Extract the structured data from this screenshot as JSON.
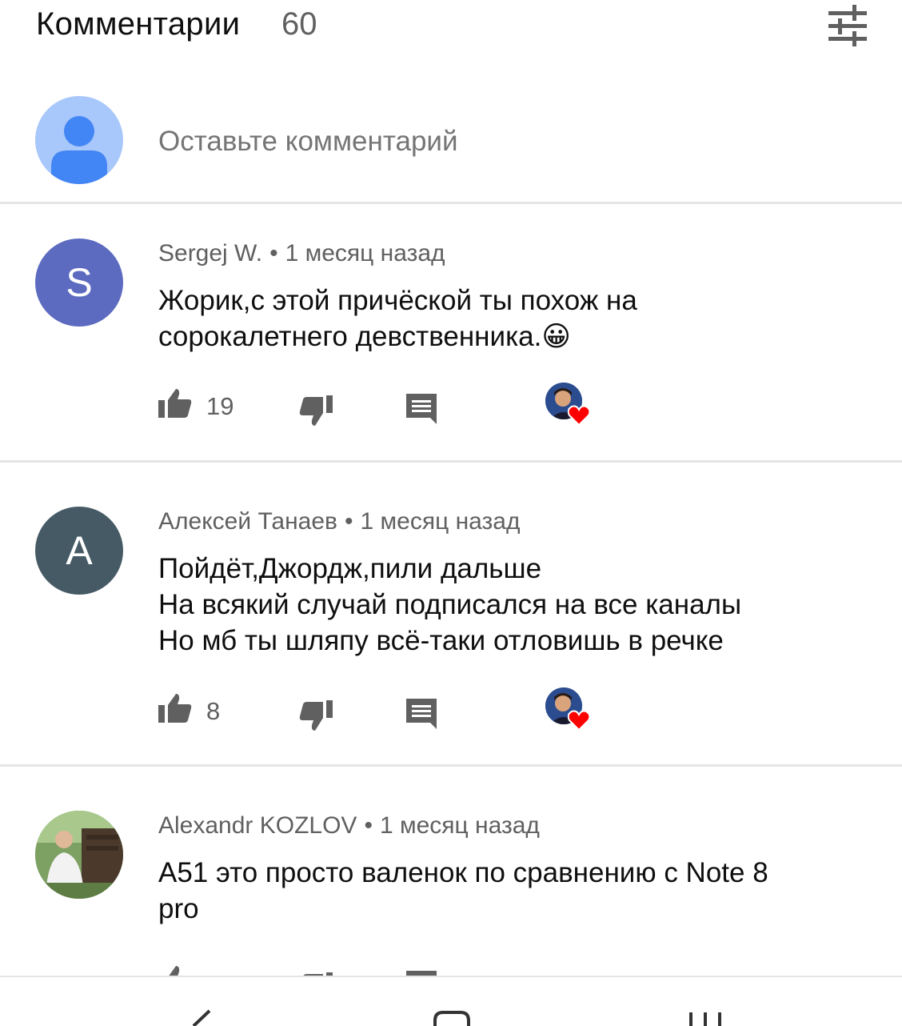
{
  "header": {
    "title": "Комментарии",
    "count": "60"
  },
  "compose": {
    "placeholder": "Оставьте комментарий"
  },
  "comments": [
    {
      "author": "Sergej W.",
      "time": "1 месяц назад",
      "avatar_letter": "S",
      "avatar_color": "#5c6bc0",
      "lines": [
        "Жорик,с этой причёской ты похож на",
        "сорокалетнего девственника."
      ],
      "emoji": "😀",
      "likes": "19"
    },
    {
      "author": "Алексей Танаев",
      "time": "1 месяц назад",
      "avatar_letter": "А",
      "avatar_color": "#455a64",
      "lines": [
        "Пойдёт,Джордж,пили дальше",
        "На всякий случай подписался на все каналы",
        "Но мб ты шляпу всё-таки отловишь в речке"
      ],
      "likes": "8"
    },
    {
      "author": "Alexandr KOZLOV",
      "time": "1 месяц назад",
      "avatar_type": "photo",
      "lines": [
        "А51 это просто валенок по сравнению с Note 8",
        "pro"
      ]
    }
  ],
  "icons": {
    "sort": "sort-filter-icon",
    "like": "thumb-up-icon",
    "dislike": "thumb-down-icon",
    "reply": "reply-comment-icon",
    "heart": "creator-heart-icon"
  },
  "colors": {
    "icon_gray": "#606060",
    "heart_red": "#ff0000",
    "compose_avatar_bg": "#a8c7fa",
    "compose_avatar_fg": "#4285f4"
  }
}
